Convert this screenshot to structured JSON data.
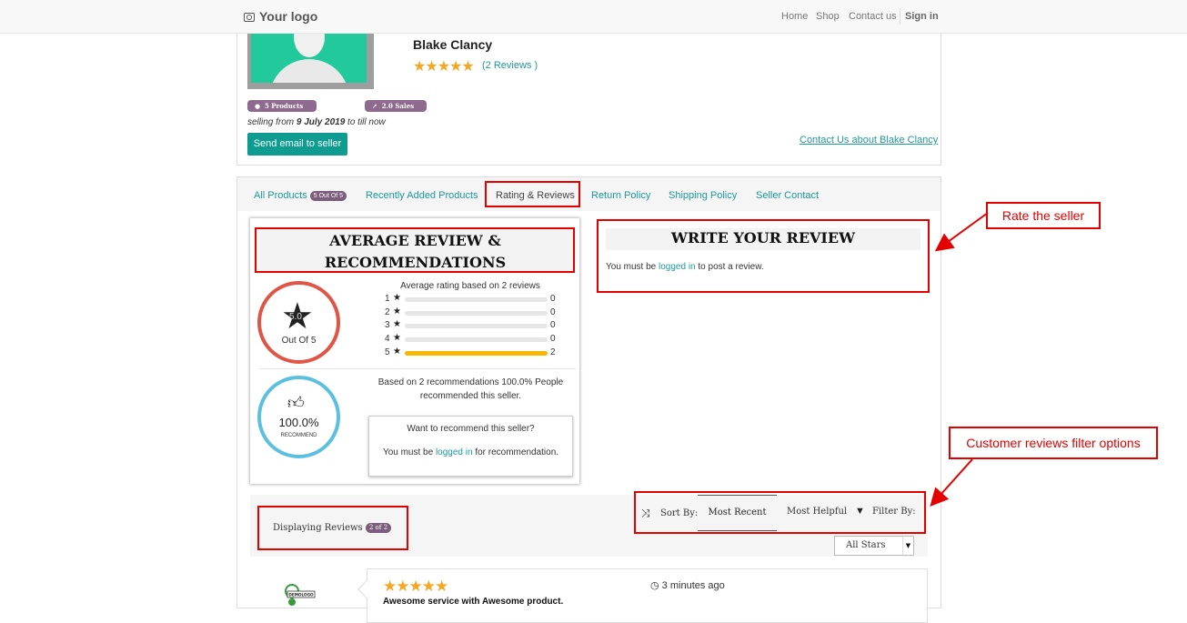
{
  "navbar": {
    "logo": "Your logo",
    "links": [
      "Home",
      "Shop",
      "Contact us"
    ],
    "signin": "Sign in"
  },
  "seller": {
    "name": "Blake Clancy",
    "stars": "★★★★★",
    "reviews_link": "(2 Reviews )",
    "products_pill": "5  Products",
    "sales_pill": "2.0  Sales",
    "selling_prefix": "selling from ",
    "selling_date": "9 July 2019",
    "selling_suffix": " to till now",
    "send_email_label": "Send email to seller",
    "contact_link": "Contact Us about Blake Clancy"
  },
  "tabs": {
    "all_products": "All Products",
    "all_products_badge": "5 Out Of 5",
    "recently_added": "Recently Added Products",
    "rating_reviews": "Rating & Reviews",
    "return_policy": "Return Policy",
    "shipping_policy": "Shipping Policy",
    "seller_contact": "Seller Contact"
  },
  "average": {
    "title_line1": "AVERAGE REVIEW &",
    "title_line2": "RECOMMENDATIONS",
    "rating_value": "5.0",
    "out_of": "Out Of 5",
    "caption": "Average rating based on 2 reviews",
    "breakdown": [
      {
        "star": "1",
        "count": "0",
        "fraction": 0
      },
      {
        "star": "2",
        "count": "0",
        "fraction": 0
      },
      {
        "star": "3",
        "count": "0",
        "fraction": 0
      },
      {
        "star": "4",
        "count": "0",
        "fraction": 0
      },
      {
        "star": "5",
        "count": "2",
        "fraction": 1
      }
    ],
    "recommend_pct": "100.0%",
    "recommend_label": "RECOMMEND",
    "recommend_caption": "Based on 2 recommendations 100.0% People recommended this seller.",
    "recommend_question": "Want to recommend this seller?",
    "recommend_login_prefix": "You must be ",
    "recommend_login_link": "logged in",
    "recommend_login_suffix": " for recommendation."
  },
  "write_review": {
    "title": "WRITE YOUR REVIEW",
    "msg_prefix": "You must be ",
    "msg_link": "logged in",
    "msg_suffix": " to post a review."
  },
  "annotations": {
    "rate_seller": "Rate the seller",
    "filter_options": "Customer reviews filter options"
  },
  "reviews_bar": {
    "displaying": "Displaying Reviews",
    "displaying_badge": "2 of 2",
    "sort_by": "Sort By:",
    "most_recent": "Most Recent",
    "most_helpful": "Most Helpful",
    "filter_by": "Filter By:",
    "stars_select": "All Stars"
  },
  "review_item": {
    "avatar_text": "DEMOLOGO",
    "stars": "★★★★★",
    "time": "3 minutes ago",
    "title": "Awesome service with Awesome product."
  },
  "colors": {
    "teal": "#1d9a9a",
    "annotation_red": "#e50000",
    "rating_ring": "#e05546",
    "recommend_ring": "#5bbfe0",
    "star_gold": "#f5a623"
  }
}
